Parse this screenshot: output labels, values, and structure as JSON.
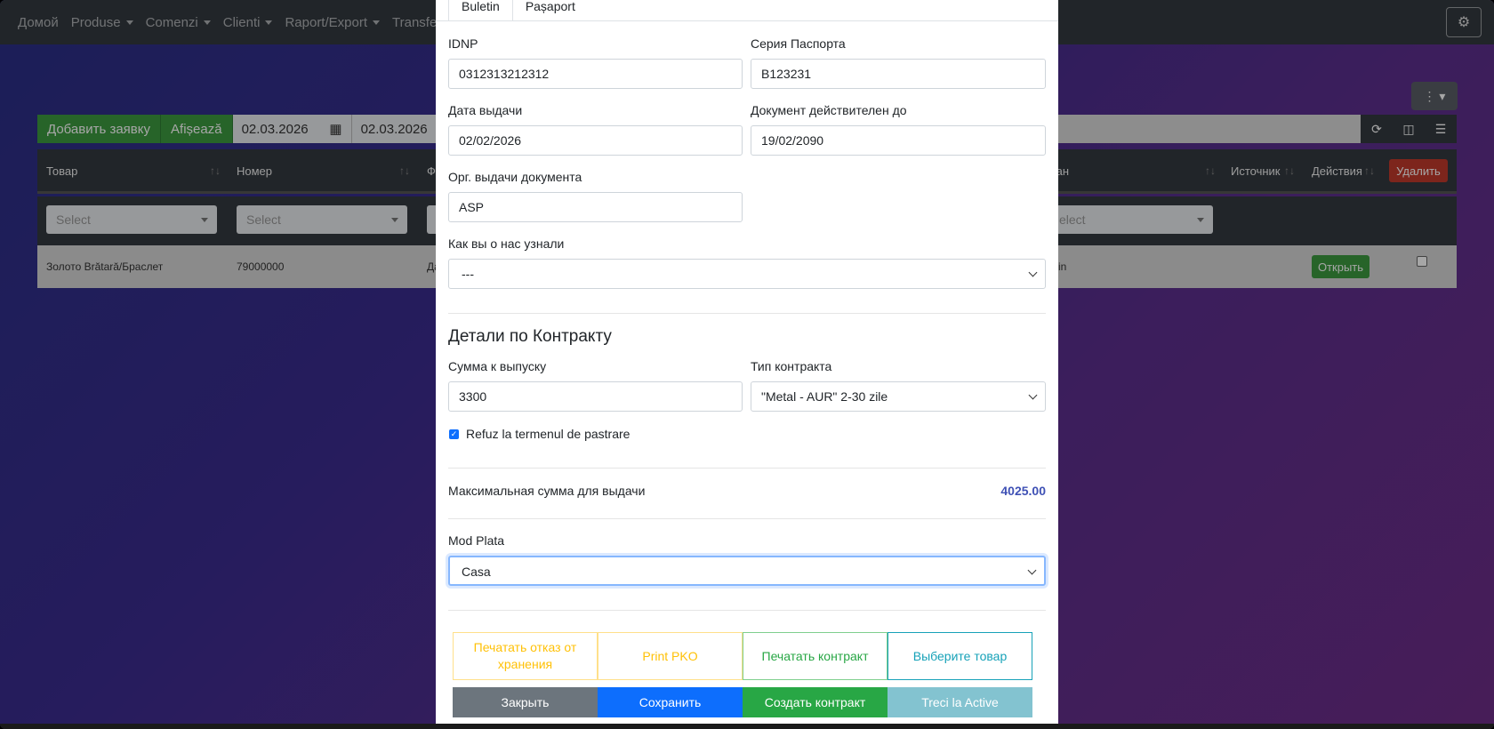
{
  "navbar": {
    "items": [
      {
        "label": "Домой",
        "dropdown": false
      },
      {
        "label": "Produse",
        "dropdown": true
      },
      {
        "label": "Comenzi",
        "dropdown": true
      },
      {
        "label": "Clienti",
        "dropdown": true
      },
      {
        "label": "Raport/Export",
        "dropdown": true
      },
      {
        "label": "Transfer B",
        "dropdown": false
      }
    ],
    "settings_icon": "gears-icon"
  },
  "toolbar": {
    "add_label": "Добавить заявку",
    "show_label": "Afișează",
    "date_from": "02.03.2026",
    "date_to": "02.03.2026"
  },
  "table": {
    "headers": {
      "tovar": "Товар",
      "nomer": "Номер",
      "f": "Ф",
      "vydan": "дан",
      "source": "Источник",
      "actions": "Действия",
      "delete": "Удалить"
    },
    "filter_placeholder": "Select",
    "filter_partial": "elect",
    "row": {
      "tovar": "Золото Brătară/Браслет",
      "nomer": "79000000",
      "f": "Да",
      "vydan": "min",
      "open_label": "Открыть"
    }
  },
  "modal": {
    "tabs": [
      "Buletin",
      "Pașaport"
    ],
    "idnp_label": "IDNP",
    "idnp_value": "0312313212312",
    "series_label": "Серия Паспорта",
    "series_value": "B123231",
    "issue_date_label": "Дата выдачи",
    "issue_date_value": "02/02/2026",
    "valid_until_label": "Документ действителен до",
    "valid_until_value": "19/02/2090",
    "issuer_label": "Орг. выдачи документа",
    "issuer_value": "ASP",
    "source_label": "Как вы о нас узнали",
    "source_value": "---",
    "contract_section": "Детали по Контракту",
    "amount_label": "Сумма к выпуску",
    "amount_value": "3300",
    "contract_type_label": "Тип контракта",
    "contract_type_value": "\"Metal - AUR\" 2-30 zile",
    "refuz_label": "Refuz la termenul de pastrare",
    "refuz_checked": true,
    "max_label": "Максимальная сумма для выдачи",
    "max_value": "4025.00",
    "pay_label": "Mod Plata",
    "pay_value": "Casa",
    "outline_buttons": [
      {
        "label": "Печатать отказ от хранения",
        "color": "#ffc107"
      },
      {
        "label": "Print PKO",
        "color": "#ffc107"
      },
      {
        "label": "Печатать контракт",
        "color": "#28a745"
      },
      {
        "label": "Выберите товар",
        "color": "#17a2b8"
      }
    ],
    "footer_buttons": [
      {
        "label": "Закрыть",
        "color": "#6c757d"
      },
      {
        "label": "Сохранить",
        "color": "#0d6efd"
      },
      {
        "label": "Создать контракт",
        "color": "#28a745"
      },
      {
        "label": "Treci la Active",
        "color": "#17a2b8"
      }
    ]
  }
}
